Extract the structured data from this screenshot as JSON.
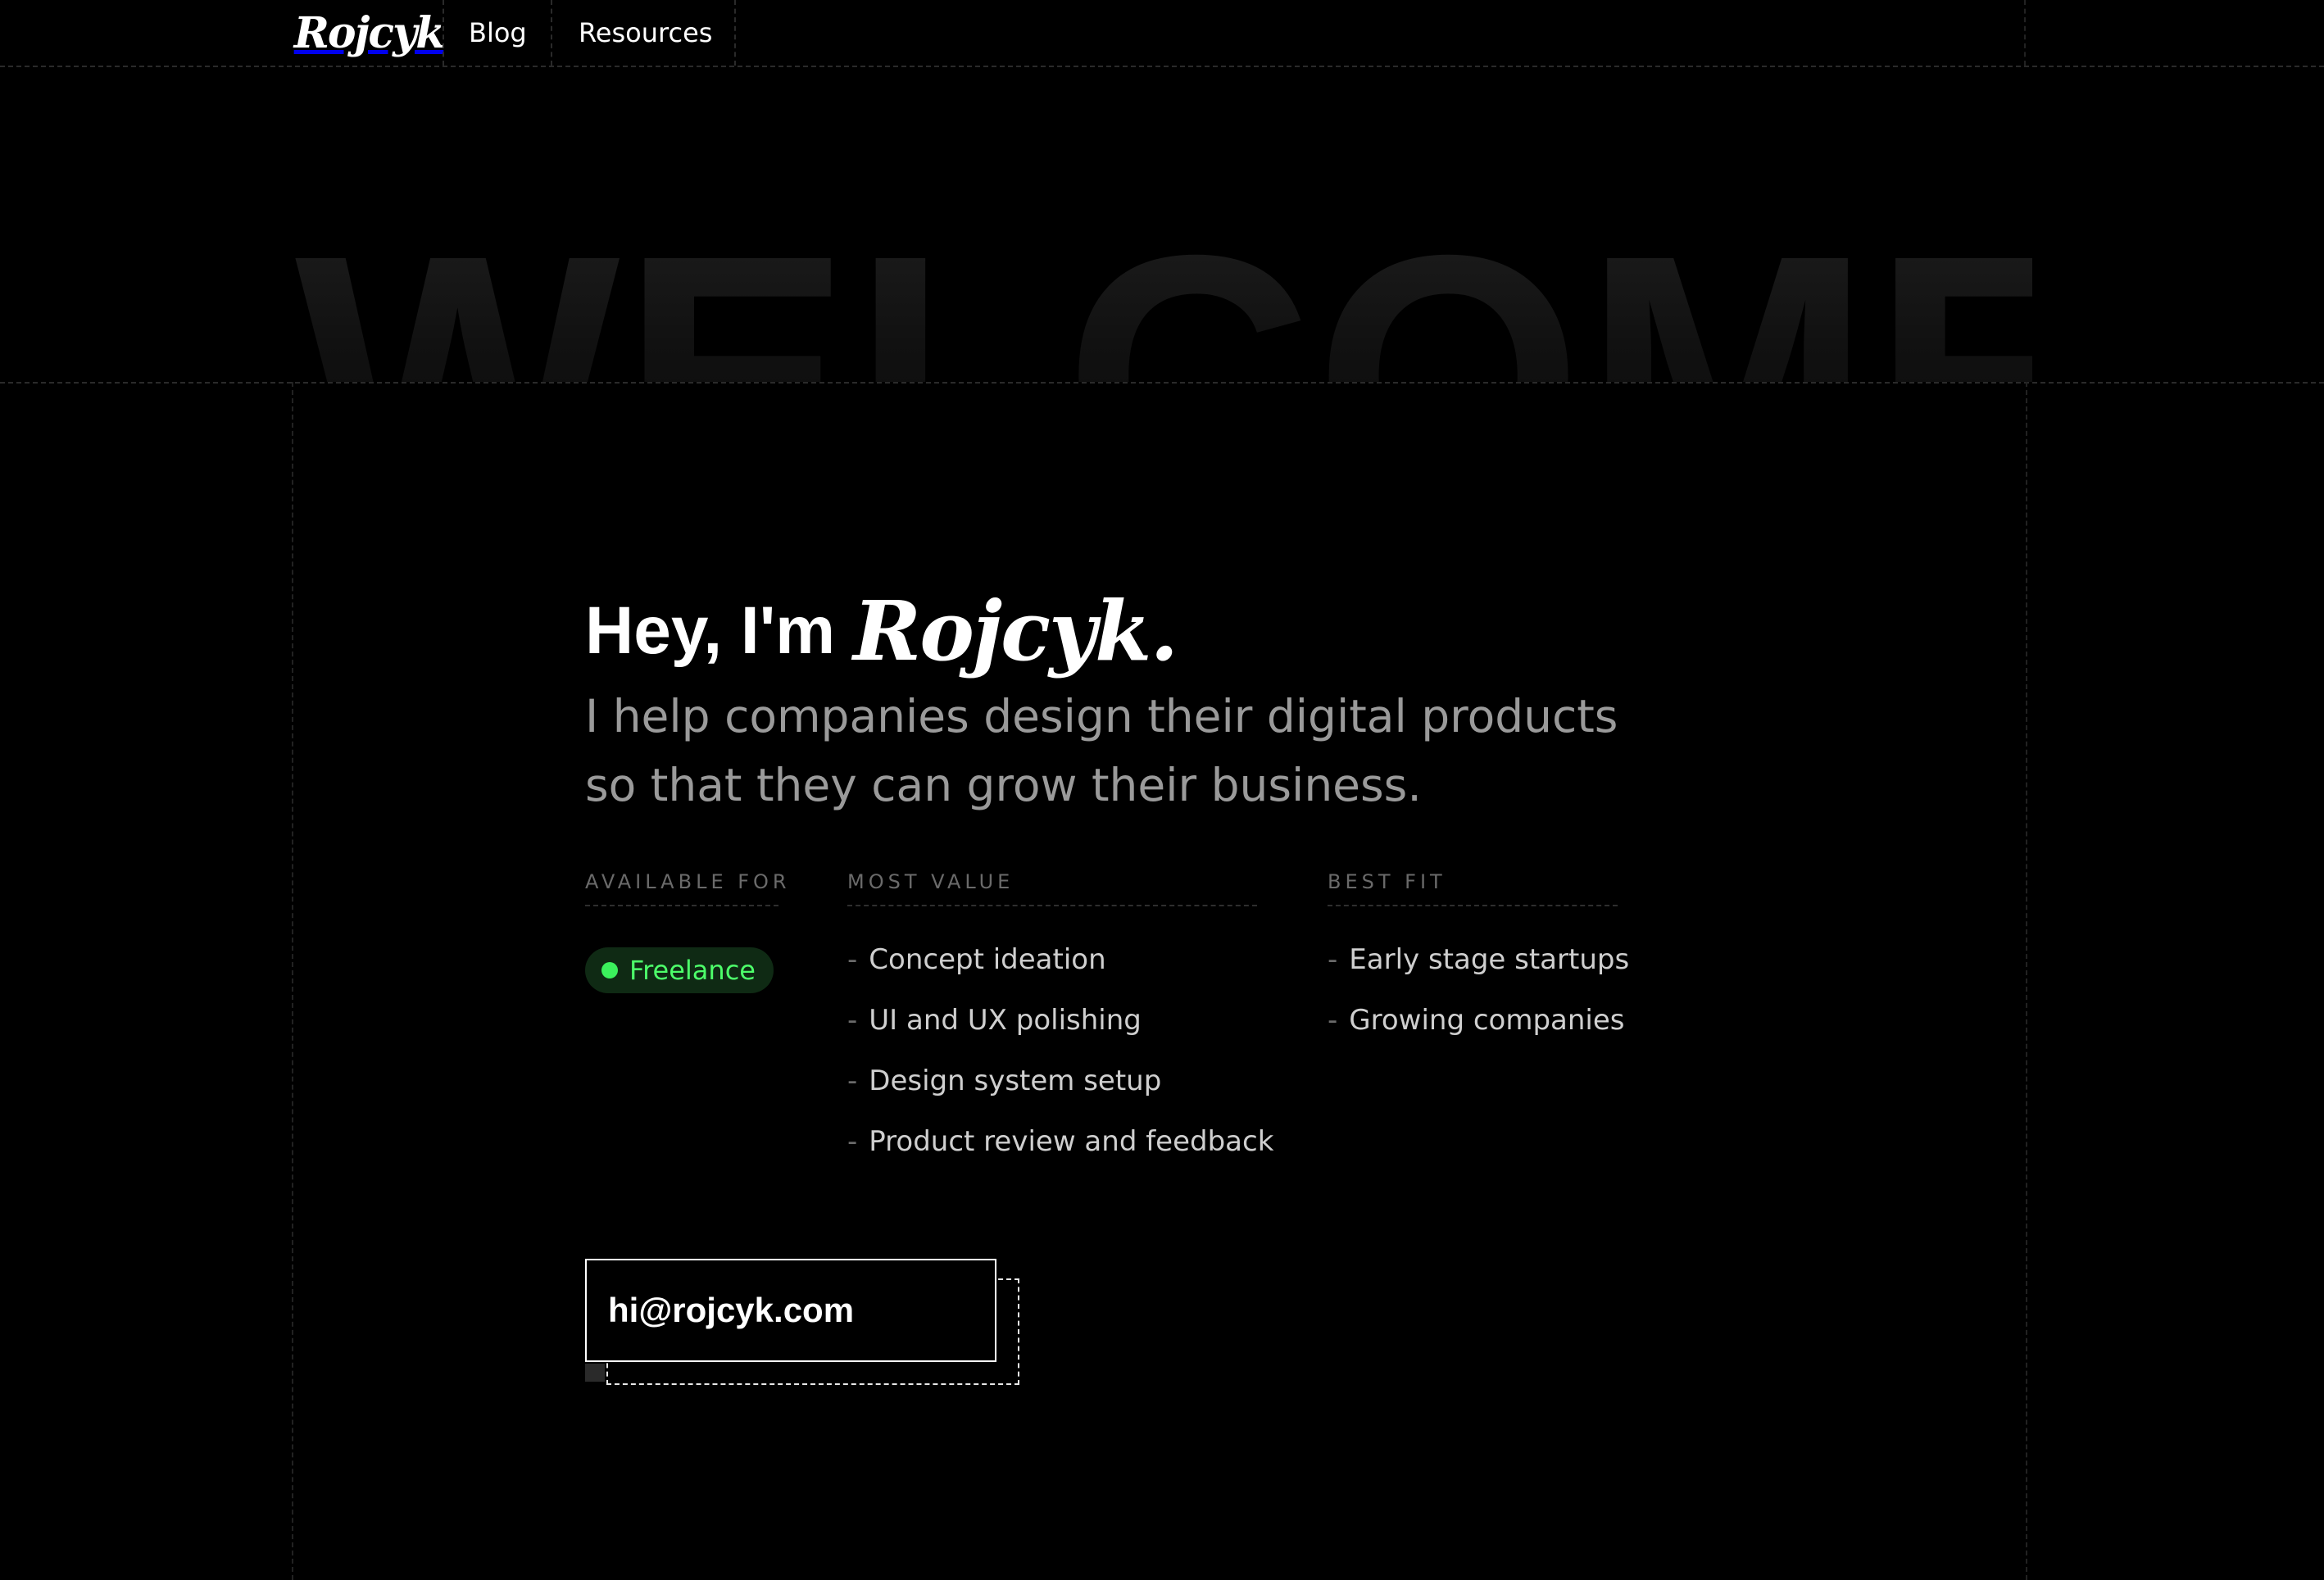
{
  "nav": {
    "logo_text": "Rojcyk",
    "links": [
      "Blog",
      "Resources"
    ]
  },
  "hero": {
    "welcome_text": "WELCOME",
    "greeting": "Hey, I'm",
    "logo_text": "Rojcyk.",
    "subtitle": "I help companies design their digital products so that they can grow their business."
  },
  "available_for": {
    "heading": "AVAILABLE FOR",
    "badge_label": "Freelance"
  },
  "most_value": {
    "heading": "MOST VALUE",
    "items": [
      "Concept ideation",
      "UI and UX polishing",
      "Design system setup",
      "Product review and feedback"
    ]
  },
  "best_fit": {
    "heading": "BEST FIT",
    "items": [
      "Early stage startups",
      "Growing companies"
    ]
  },
  "contact": {
    "email": "hi@rojcyk.com"
  },
  "colors": {
    "background": "#000000",
    "accent_green": "#3bf05c",
    "badge_bg": "#0f2a14",
    "muted_text": "#9a9a9a"
  }
}
